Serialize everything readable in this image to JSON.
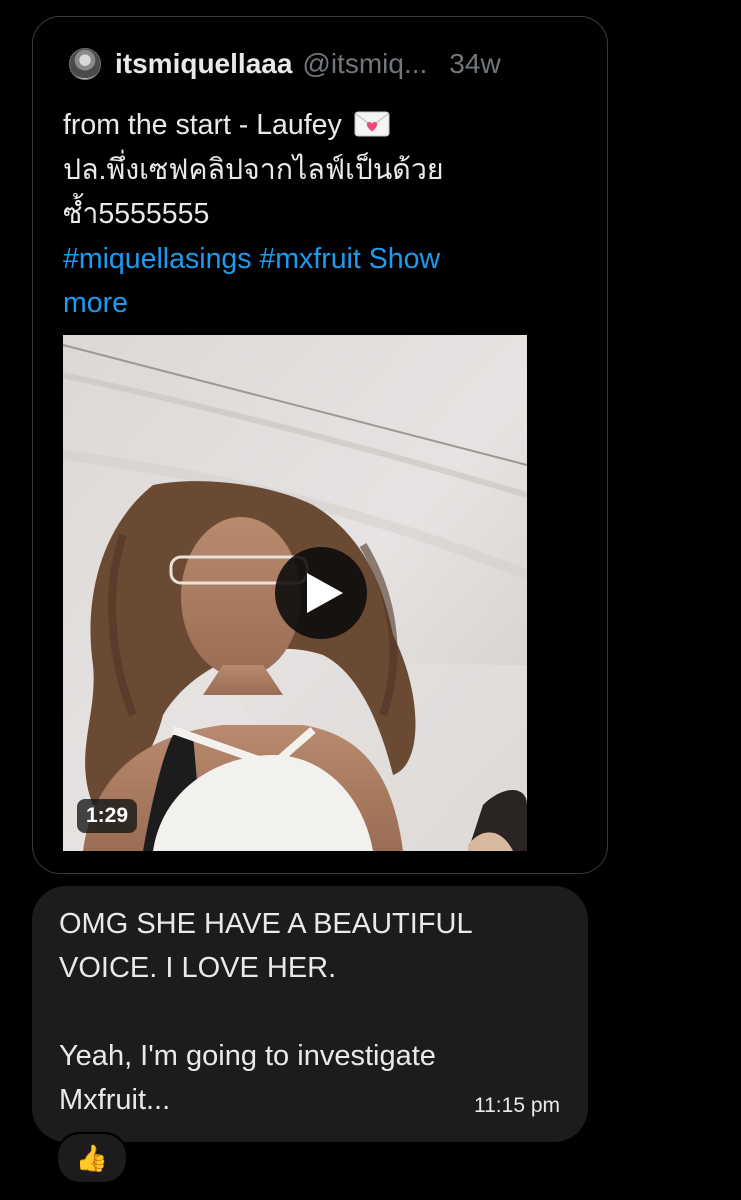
{
  "tweet": {
    "display_name": "itsmiquellaaa",
    "handle": "@itsmiq...",
    "time_ago": "34w",
    "text_line_1": "from the start - Laufey",
    "text_line_2": "ปล.พึ่งเซฟคลิปจากไลฟ์เป็นด้วย",
    "text_line_3": "ซ้ำ5555555",
    "hashtag_1": "#miquellasings",
    "hashtag_2": "#mxfruit",
    "show_more_1": "Show",
    "show_more_2": "more",
    "emoji_icon": "love-letter-icon",
    "video": {
      "duration": "1:29"
    }
  },
  "message": {
    "line_1": "OMG SHE HAVE A BEAUTIFUL",
    "line_2": "VOICE. I LOVE HER.",
    "line_3": "Yeah, I'm going to investigate",
    "line_4": "Mxfruit...",
    "time": "11:15 pm"
  },
  "reaction": {
    "emoji": "👍"
  },
  "colors": {
    "background": "#000000",
    "link": "#1d9bf0",
    "muted": "#71767b",
    "bubble": "#1c1c1e",
    "card_border": "#3a3a3c"
  }
}
